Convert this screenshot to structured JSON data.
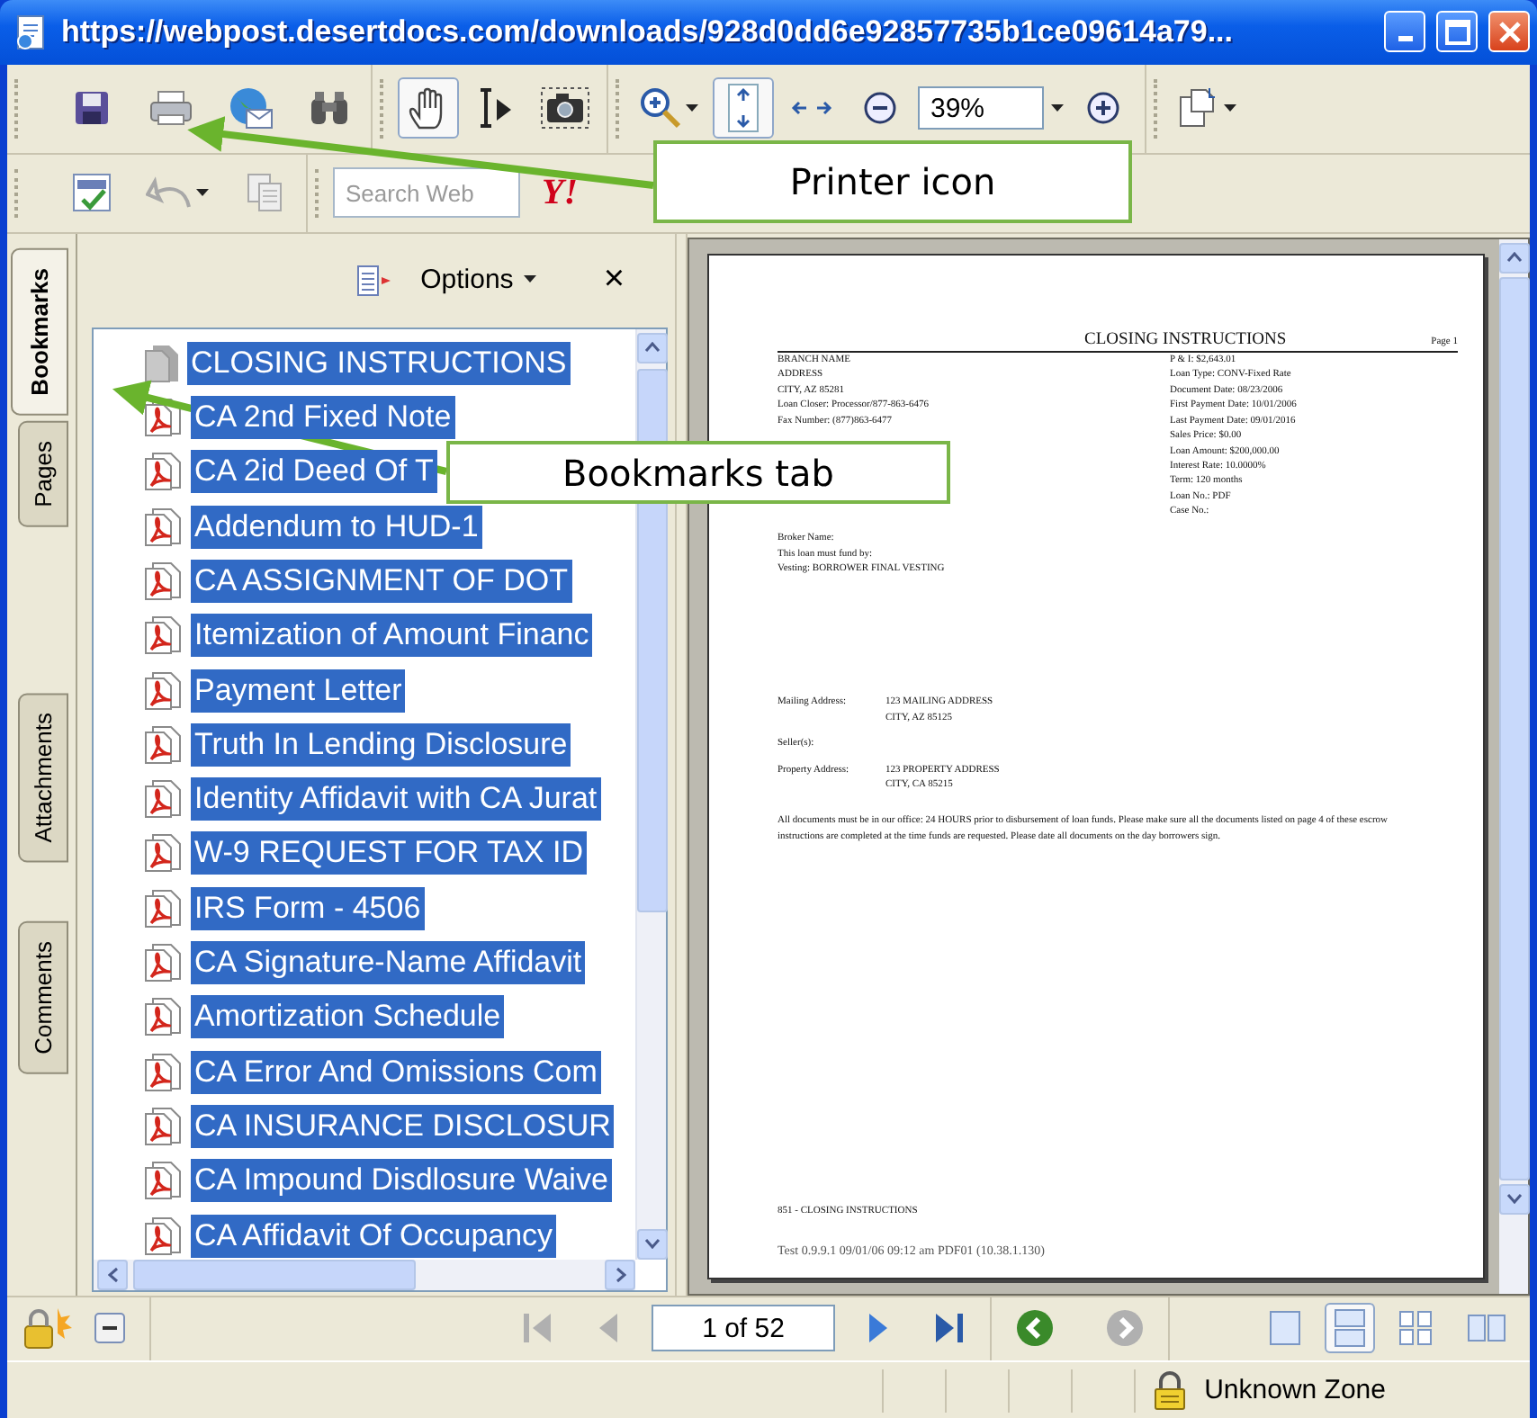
{
  "window": {
    "title": "https://webpost.desertdocs.com/downloads/928d0dd6e92857735b1ce09614a79..."
  },
  "toolbar": {
    "hand_tool": {
      "selected": true
    },
    "select_tool": {
      "selected": false
    },
    "fit_height": {
      "selected": true
    },
    "fit_width": {
      "selected": false
    },
    "zoom": {
      "value": "39%"
    },
    "search": {
      "placeholder": "Search Web"
    },
    "search_logo": "Y!"
  },
  "side_tabs": [
    {
      "label": "Bookmarks",
      "selected": true
    },
    {
      "label": "Pages",
      "selected": false
    },
    {
      "label": "Attachments",
      "selected": false
    },
    {
      "label": "Comments",
      "selected": false
    }
  ],
  "bookmarks": {
    "options_label": "Options",
    "close_label": "×",
    "items": [
      {
        "kind": "page",
        "label": "CLOSING INSTRUCTIONS",
        "selected": true
      },
      {
        "kind": "pdf",
        "label": "CA 2nd Fixed Note",
        "selected": true
      },
      {
        "kind": "pdf",
        "label": "CA 2id Deed Of T",
        "selected": true
      },
      {
        "kind": "pdf",
        "label": "Addendum to HUD-1",
        "selected": true
      },
      {
        "kind": "pdf",
        "label": "CA ASSIGNMENT OF DOT",
        "selected": true
      },
      {
        "kind": "pdf",
        "label": "Itemization of Amount Financ",
        "selected": true
      },
      {
        "kind": "pdf",
        "label": "Payment Letter",
        "selected": true
      },
      {
        "kind": "pdf",
        "label": "Truth In Lending Disclosure",
        "selected": true
      },
      {
        "kind": "pdf",
        "label": "Identity Affidavit with CA Jurat",
        "selected": true
      },
      {
        "kind": "pdf",
        "label": "W-9 REQUEST FOR TAX ID",
        "selected": true
      },
      {
        "kind": "pdf",
        "label": "IRS Form - 4506",
        "selected": true
      },
      {
        "kind": "pdf",
        "label": "CA Signature-Name Affidavit",
        "selected": true
      },
      {
        "kind": "pdf",
        "label": "Amortization Schedule",
        "selected": true
      },
      {
        "kind": "pdf",
        "label": "CA Error And Omissions Com",
        "selected": true
      },
      {
        "kind": "pdf",
        "label": "CA INSURANCE DISCLOSUR",
        "selected": true
      },
      {
        "kind": "pdf",
        "label": "CA Impound Disdlosure Waive",
        "selected": true
      },
      {
        "kind": "pdf",
        "label": "CA Affidavit Of Occupancy",
        "selected": true
      }
    ]
  },
  "document": {
    "title": "CLOSING INSTRUCTIONS",
    "page_label": "Page 1",
    "left_block": [
      "BRANCH NAME",
      "ADDRESS",
      "CITY, AZ 85281",
      "Loan Closer: Processor/877-863-6476",
      "Fax Number: (877)863-6477"
    ],
    "right_block": [
      "P & I: $2,643.01",
      "Loan Type: CONV-Fixed Rate",
      "Document Date: 08/23/2006",
      "First Payment Date: 10/01/2006",
      "Last Payment Date: 09/01/2016",
      "Sales Price: $0.00",
      "Loan Amount: $200,000.00",
      "Interest Rate: 10.0000%",
      "Term: 120 months",
      "Loan No.: PDF",
      "Case No.:"
    ],
    "broker_block": [
      "Broker Name:",
      "This loan must fund by:",
      "Vesting: BORROWER FINAL VESTING"
    ],
    "addresses": [
      {
        "label": "Mailing Address:",
        "lines": [
          "123 MAILING ADDRESS",
          "CITY, AZ 85125"
        ]
      },
      {
        "label": "Seller(s):"
      },
      {
        "label": "Property Address:",
        "lines": [
          "123 PROPERTY ADDRESS",
          "CITY, CA 85215"
        ]
      }
    ],
    "paragraph": "All documents must be in our office: 24 HOURS prior to disbursement of loan funds. Please make sure all the documents listed on page 4 of these escrow instructions are completed at the time funds are requested. Please date all documents on the day borrowers sign.",
    "footer_code": "851 - CLOSING INSTRUCTIONS",
    "footer_stamp": "Test 0.9.9.1 09/01/06 09:12 am PDF01 (10.38.1.130)"
  },
  "navigation": {
    "page_field": {
      "value": "1 of 52"
    },
    "first_page": {
      "disabled": true
    },
    "previous_page": {
      "disabled": true
    },
    "next_page": {
      "disabled": false
    },
    "last_page": {
      "disabled": false
    },
    "back": {
      "disabled": false
    },
    "forward": {
      "disabled": true
    }
  },
  "view_modes": [
    {
      "kind": "single",
      "selected": false
    },
    {
      "kind": "continuous",
      "selected": true
    },
    {
      "kind": "grid",
      "selected": false
    },
    {
      "kind": "facing",
      "selected": false
    }
  ],
  "status_bar": {
    "zone": "Unknown Zone"
  },
  "callouts": [
    {
      "label": "Printer icon"
    },
    {
      "label": "Bookmarks tab"
    }
  ]
}
